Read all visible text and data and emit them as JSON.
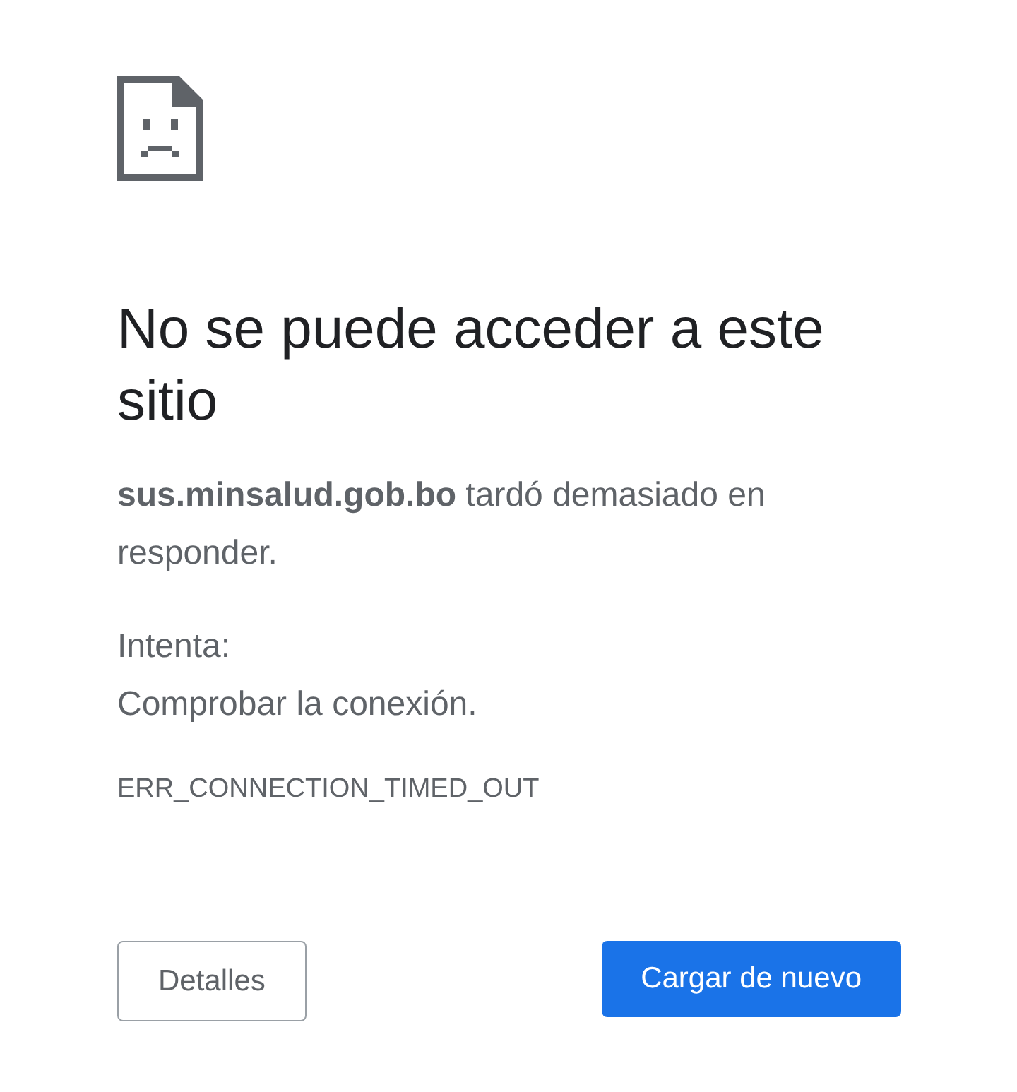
{
  "title": "No se puede acceder a este sitio",
  "message": "**sus.minsalud.gob.bo** tardó demasiado en responder.",
  "suggestions_heading": "Intenta:",
  "suggestions": [
    "Comprobar la conexión."
  ],
  "error_code": "ERR_CONNECTION_TIMED_OUT",
  "buttons": [
    {
      "label": "Detalles",
      "kind": "secondary"
    },
    {
      "label": "Cargar de nuevo",
      "kind": "primary"
    }
  ]
}
